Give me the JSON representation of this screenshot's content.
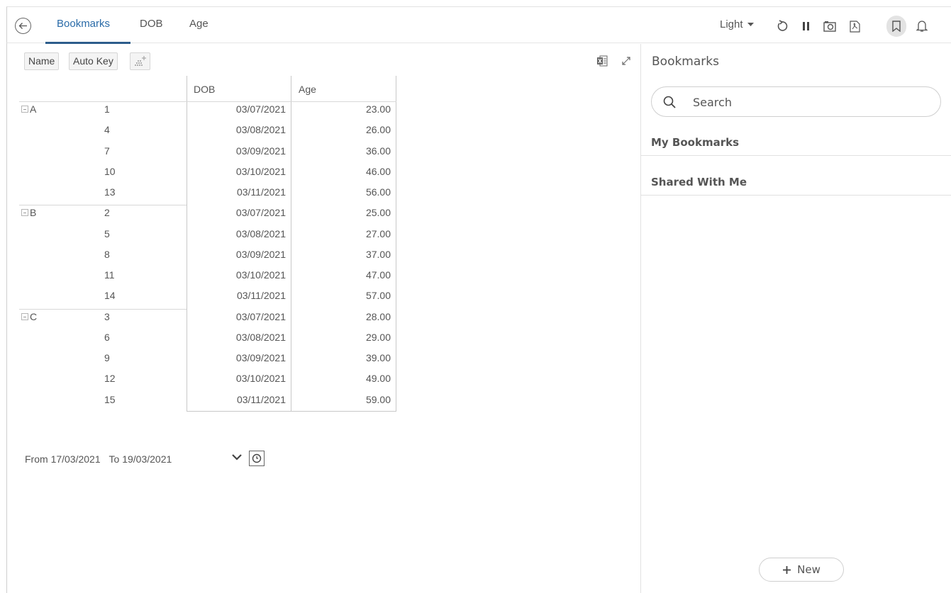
{
  "tabs": [
    {
      "label": "Bookmarks",
      "active": true
    },
    {
      "label": "DOB",
      "active": false
    },
    {
      "label": "Age",
      "active": false
    }
  ],
  "toolbar": {
    "theme": "Light",
    "icons": [
      "refresh-icon",
      "pause-icon",
      "snapshot-icon",
      "pdf-icon",
      "bookmark-icon",
      "bell-icon"
    ]
  },
  "chips": [
    "Name",
    "Auto Key"
  ],
  "table": {
    "columns": [
      "DOB",
      "Age"
    ],
    "groups": [
      {
        "name": "A",
        "rows": [
          {
            "key": "1",
            "dob": "03/07/2021",
            "age": "23.00"
          },
          {
            "key": "4",
            "dob": "03/08/2021",
            "age": "26.00"
          },
          {
            "key": "7",
            "dob": "03/09/2021",
            "age": "36.00"
          },
          {
            "key": "10",
            "dob": "03/10/2021",
            "age": "46.00"
          },
          {
            "key": "13",
            "dob": "03/11/2021",
            "age": "56.00"
          }
        ]
      },
      {
        "name": "B",
        "rows": [
          {
            "key": "2",
            "dob": "03/07/2021",
            "age": "25.00"
          },
          {
            "key": "5",
            "dob": "03/08/2021",
            "age": "27.00"
          },
          {
            "key": "8",
            "dob": "03/09/2021",
            "age": "37.00"
          },
          {
            "key": "11",
            "dob": "03/10/2021",
            "age": "47.00"
          },
          {
            "key": "14",
            "dob": "03/11/2021",
            "age": "57.00"
          }
        ]
      },
      {
        "name": "C",
        "rows": [
          {
            "key": "3",
            "dob": "03/07/2021",
            "age": "28.00"
          },
          {
            "key": "6",
            "dob": "03/08/2021",
            "age": "29.00"
          },
          {
            "key": "9",
            "dob": "03/09/2021",
            "age": "39.00"
          },
          {
            "key": "12",
            "dob": "03/10/2021",
            "age": "49.00"
          },
          {
            "key": "15",
            "dob": "03/11/2021",
            "age": "59.00"
          }
        ]
      }
    ]
  },
  "date_range": {
    "from_label": "From",
    "from": "17/03/2021",
    "to_label": "To",
    "to": "19/03/2021"
  },
  "panel": {
    "title": "Bookmarks",
    "search_placeholder": "Search",
    "sections": [
      "My Bookmarks",
      "Shared With Me"
    ],
    "new_label": "New"
  },
  "colors": {
    "accent": "#2a6ba8",
    "underline": "#2d5d8c"
  }
}
